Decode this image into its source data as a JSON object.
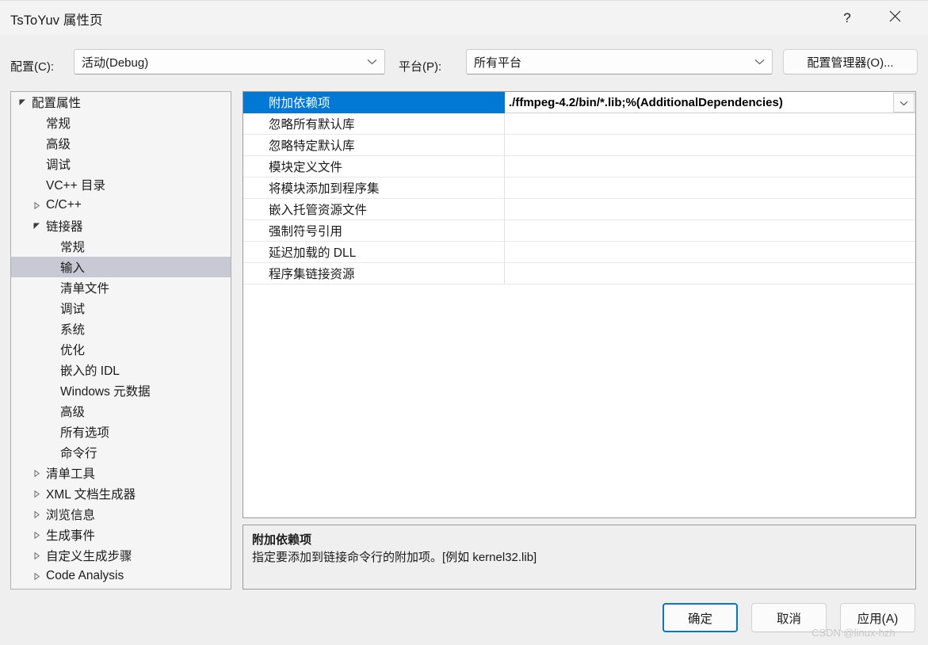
{
  "window": {
    "title": "TsToYuv 属性页",
    "help_icon": "question-mark-icon",
    "help_glyph": "?",
    "close_icon": "close-icon"
  },
  "toolbar": {
    "config_label": "配置(C):",
    "config_value": "活动(Debug)",
    "platform_label": "平台(P):",
    "platform_value": "所有平台",
    "config_manager_button": "配置管理器(O)..."
  },
  "sidebar": {
    "items": [
      {
        "label": "配置属性",
        "indent": 0,
        "marker": "expanded",
        "selected": false
      },
      {
        "label": "常规",
        "indent": 1,
        "marker": "none",
        "selected": false
      },
      {
        "label": "高级",
        "indent": 1,
        "marker": "none",
        "selected": false
      },
      {
        "label": "调试",
        "indent": 1,
        "marker": "none",
        "selected": false
      },
      {
        "label": "VC++ 目录",
        "indent": 1,
        "marker": "none",
        "selected": false
      },
      {
        "label": "C/C++",
        "indent": 1,
        "marker": "collapsed",
        "selected": false
      },
      {
        "label": "链接器",
        "indent": 1,
        "marker": "expanded",
        "selected": false
      },
      {
        "label": "常规",
        "indent": 2,
        "marker": "none",
        "selected": false
      },
      {
        "label": "输入",
        "indent": 2,
        "marker": "none",
        "selected": true
      },
      {
        "label": "清单文件",
        "indent": 2,
        "marker": "none",
        "selected": false
      },
      {
        "label": "调试",
        "indent": 2,
        "marker": "none",
        "selected": false
      },
      {
        "label": "系统",
        "indent": 2,
        "marker": "none",
        "selected": false
      },
      {
        "label": "优化",
        "indent": 2,
        "marker": "none",
        "selected": false
      },
      {
        "label": "嵌入的 IDL",
        "indent": 2,
        "marker": "none",
        "selected": false
      },
      {
        "label": "Windows 元数据",
        "indent": 2,
        "marker": "none",
        "selected": false
      },
      {
        "label": "高级",
        "indent": 2,
        "marker": "none",
        "selected": false
      },
      {
        "label": "所有选项",
        "indent": 2,
        "marker": "none",
        "selected": false
      },
      {
        "label": "命令行",
        "indent": 2,
        "marker": "none",
        "selected": false
      },
      {
        "label": "清单工具",
        "indent": 1,
        "marker": "collapsed",
        "selected": false
      },
      {
        "label": "XML 文档生成器",
        "indent": 1,
        "marker": "collapsed",
        "selected": false
      },
      {
        "label": "浏览信息",
        "indent": 1,
        "marker": "collapsed",
        "selected": false
      },
      {
        "label": "生成事件",
        "indent": 1,
        "marker": "collapsed",
        "selected": false
      },
      {
        "label": "自定义生成步骤",
        "indent": 1,
        "marker": "collapsed",
        "selected": false
      },
      {
        "label": "Code Analysis",
        "indent": 1,
        "marker": "collapsed",
        "selected": false
      }
    ]
  },
  "grid": {
    "rows": [
      {
        "name": "附加依赖项",
        "value": "./ffmpeg-4.2/bin/*.lib;%(AdditionalDependencies)",
        "selected": true
      },
      {
        "name": "忽略所有默认库",
        "value": "",
        "selected": false
      },
      {
        "name": "忽略特定默认库",
        "value": "",
        "selected": false
      },
      {
        "name": "模块定义文件",
        "value": "",
        "selected": false
      },
      {
        "name": "将模块添加到程序集",
        "value": "",
        "selected": false
      },
      {
        "name": "嵌入托管资源文件",
        "value": "",
        "selected": false
      },
      {
        "name": "强制符号引用",
        "value": "",
        "selected": false
      },
      {
        "name": "延迟加载的 DLL",
        "value": "",
        "selected": false
      },
      {
        "name": "程序集链接资源",
        "value": "",
        "selected": false
      }
    ],
    "dropdown_icon": "chevron-down-icon"
  },
  "description": {
    "title": "附加依赖项",
    "body": "指定要添加到链接命令行的附加项。[例如 kernel32.lib]"
  },
  "footer": {
    "ok": "确定",
    "cancel": "取消",
    "apply": "应用(A)"
  },
  "watermark": "CSDN @linux-hzh",
  "colors": {
    "accent": "#0078d4",
    "window_bg": "#efefef",
    "titlebar_bg": "#f3f3f3",
    "tree_selection": "#c9c9d6",
    "grid_selection": "#0078d4"
  }
}
